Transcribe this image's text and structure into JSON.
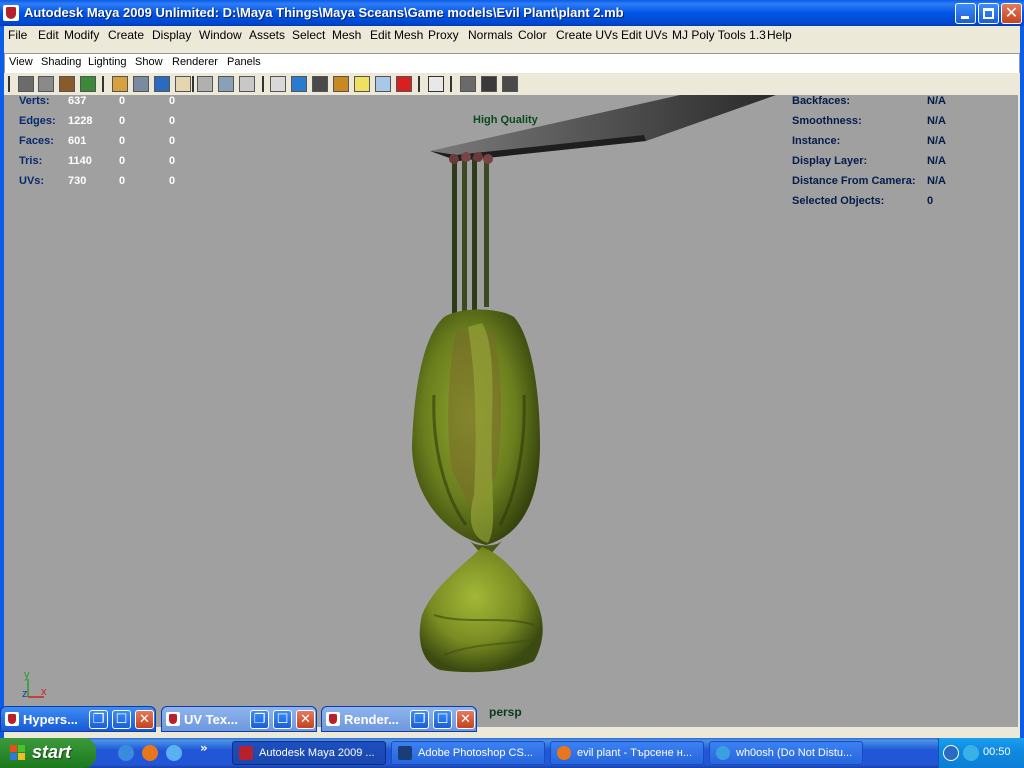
{
  "window": {
    "title": "Autodesk Maya 2009 Unlimited: D:\\Maya Things\\Maya Sceans\\Game models\\Evil Plant\\plant 2.mb",
    "min_glyph": "",
    "max_glyph": "",
    "close_glyph": "✕"
  },
  "menubar": [
    "File",
    "Edit",
    "Modify",
    "Create",
    "Display",
    "Window",
    "Assets",
    "Select",
    "Mesh",
    "Edit Mesh",
    "Proxy",
    "Normals",
    "Color",
    "Create UVs",
    "Edit UVs",
    "MJ Poly Tools 1.3",
    "Help"
  ],
  "panel_menu": [
    "View",
    "Shading",
    "Lighting",
    "Show",
    "Renderer",
    "Panels"
  ],
  "hud": {
    "left": [
      {
        "label": "Verts:",
        "v1": "637",
        "v2": "0",
        "v3": "0"
      },
      {
        "label": "Edges:",
        "v1": "1228",
        "v2": "0",
        "v3": "0"
      },
      {
        "label": "Faces:",
        "v1": "601",
        "v2": "0",
        "v3": "0"
      },
      {
        "label": "Tris:",
        "v1": "1140",
        "v2": "0",
        "v3": "0"
      },
      {
        "label": "UVs:",
        "v1": "730",
        "v2": "0",
        "v3": "0"
      }
    ],
    "center": "High Quality",
    "right": [
      {
        "label": "Backfaces:",
        "value": "N/A"
      },
      {
        "label": "Smoothness:",
        "value": "N/A"
      },
      {
        "label": "Instance:",
        "value": "N/A"
      },
      {
        "label": "Display Layer:",
        "value": "N/A"
      },
      {
        "label": "Distance From Camera:",
        "value": "N/A"
      },
      {
        "label": "Selected Objects:",
        "value": "0"
      }
    ],
    "axis": {
      "y": "y",
      "z": "z",
      "x": "x"
    },
    "camera": "persp"
  },
  "minimized": [
    {
      "title": "Hypers..."
    },
    {
      "title": "UV Tex..."
    },
    {
      "title": "Render..."
    }
  ],
  "taskbar": {
    "start": "start",
    "chevron": "»",
    "tasks": [
      {
        "label": "Autodesk Maya 2009 ...",
        "icon_color": "#b8202c"
      },
      {
        "label": "Adobe Photoshop CS...",
        "icon_color": "#1c3c78"
      },
      {
        "label": "evil plant - Търсене н...",
        "icon_color": "#e8761c"
      },
      {
        "label": "wh0osh (Do Not Distu...",
        "icon_color": "#3aa0e0"
      }
    ],
    "clock": "00:50"
  },
  "colors": {
    "viewport_bg": "#a0a0a0",
    "plant_dark": "#3a4a12",
    "plant_light": "#8fa62e",
    "xp_blue": "#0055e5"
  }
}
